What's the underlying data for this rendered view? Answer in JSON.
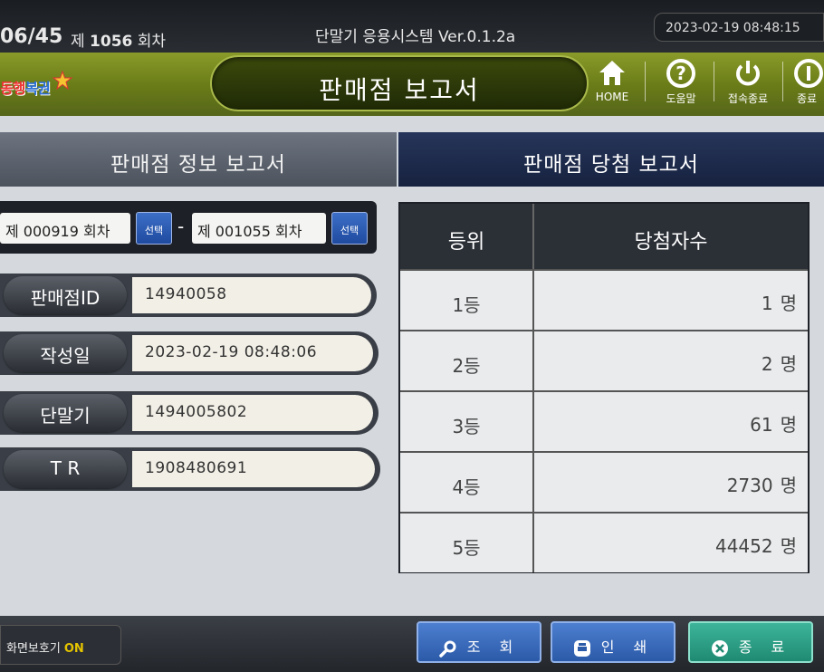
{
  "status": {
    "counter": "06/45",
    "round_prefix": "제",
    "round_number": "1056",
    "round_suffix": "회차",
    "system_name": "단말기 응용시스템",
    "version": "Ver.0.1.2a",
    "datetime": "2023-02-19  08:48:15"
  },
  "header": {
    "logo_text_a": "동행",
    "logo_text_b": "복권",
    "title": "판매점 보고서",
    "nav": {
      "home": "HOME",
      "help": "도움말",
      "logout": "접속종료",
      "exit": "종료"
    }
  },
  "tabs": {
    "info": "판매점 정보 보고서",
    "win": "판매점 당첨 보고서"
  },
  "range": {
    "from": "제 000919 회차",
    "to": "제 001055 회차",
    "select_label": "선택"
  },
  "info": {
    "store_id_label": "판매점ID",
    "store_id": "14940058",
    "created_label": "작성일",
    "created": "2023-02-19  08:48:06",
    "terminal_label": "단말기",
    "terminal": "1494005802",
    "tr_label": "T R",
    "tr": "1908480691"
  },
  "win_table": {
    "headers": [
      "등위",
      "당첨자수"
    ],
    "unit": "명",
    "rows": [
      {
        "rank": "1등",
        "count": "1"
      },
      {
        "rank": "2등",
        "count": "2"
      },
      {
        "rank": "3등",
        "count": "61"
      },
      {
        "rank": "4등",
        "count": "2730"
      },
      {
        "rank": "5등",
        "count": "44452"
      }
    ]
  },
  "bottom": {
    "screensaver_label": "화면보호기",
    "screensaver_state": "ON",
    "search": "조 회",
    "print": "인 쇄",
    "close": "종 료"
  },
  "colors": {
    "title_green": "#6b7d18",
    "tab_active": "#17223f",
    "button_blue": "#2b5aa8",
    "button_teal": "#1f8a72",
    "screensaver_on": "#e5c400"
  }
}
